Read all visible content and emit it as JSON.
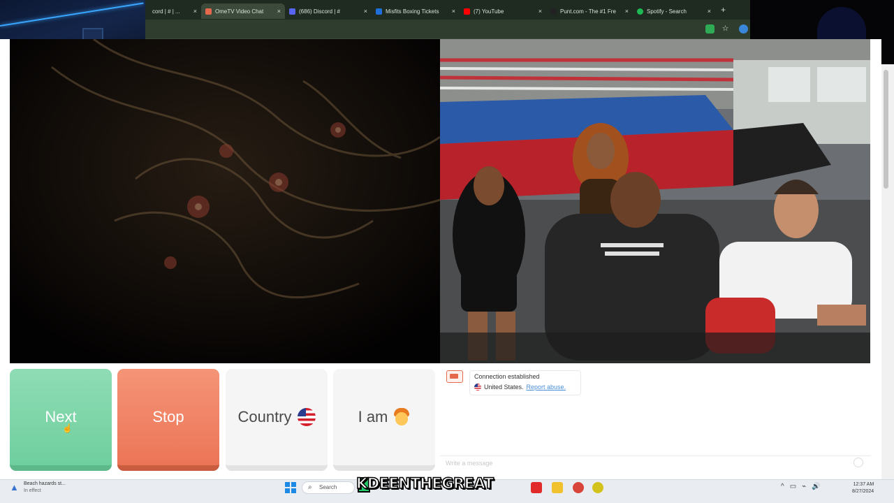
{
  "browser": {
    "tabs": [
      {
        "label": "cord | # | ...",
        "favicon_color": "#5865f2",
        "active": false
      },
      {
        "label": "OmeTV Video Chat",
        "favicon_color": "#e56a4d",
        "active": true
      },
      {
        "label": "(686) Discord | #",
        "favicon_color": "#5865f2",
        "active": false
      },
      {
        "label": "Misfits Boxing Tickets",
        "favicon_color": "#1e6fd9",
        "active": false
      },
      {
        "label": "(7) YouTube",
        "favicon_color": "#ff0000",
        "active": false
      },
      {
        "label": "Punt.com - The #1 Fre",
        "favicon_color": "#222222",
        "active": false
      },
      {
        "label": "Spotify - Search",
        "favicon_color": "#1db954",
        "active": false
      }
    ],
    "new_tab": "+",
    "close_glyph": "×"
  },
  "controls": {
    "next_label": "Next",
    "stop_label": "Stop",
    "country_label": "Country",
    "iam_label": "I am"
  },
  "chat": {
    "status": "Connection established",
    "country": "United States.",
    "report_link": "Report abuse.",
    "input_placeholder": "Write a message"
  },
  "taskbar": {
    "weather_title": "Beach hazards st...",
    "weather_sub": "In effect",
    "search_label": "Search",
    "watermark": "KDEENTHEGREAT",
    "clock_time": "12:37 AM",
    "clock_date": "8/27/2024"
  },
  "colors": {
    "next": "#6fcf9e",
    "stop": "#ec7557",
    "accent": "#e56a4d"
  }
}
